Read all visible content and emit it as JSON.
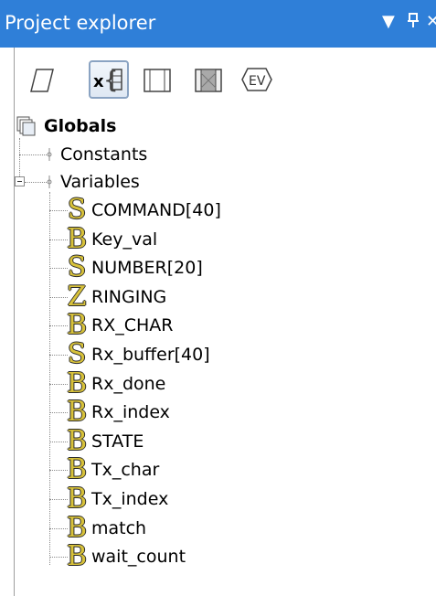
{
  "panel": {
    "title": "Project explorer"
  },
  "titlebar_icons": {
    "dropdown": "dropdown-arrow-icon",
    "pin": "pin-icon",
    "close": "close-icon"
  },
  "toolbar": {
    "tools": [
      {
        "name": "flowchart-icon",
        "active": false
      },
      {
        "name": "variables-icon",
        "active": true
      },
      {
        "name": "macro-icon",
        "active": false
      },
      {
        "name": "component-macro-icon",
        "active": false
      },
      {
        "name": "events-icon",
        "active": false,
        "label": "EV"
      }
    ]
  },
  "tree": {
    "root": {
      "label": "Globals"
    },
    "constants": {
      "label": "Constants"
    },
    "variables": {
      "label": "Variables",
      "items": [
        {
          "type": "S",
          "label": "COMMAND[40]"
        },
        {
          "type": "B",
          "label": "Key_val"
        },
        {
          "type": "S",
          "label": "NUMBER[20]"
        },
        {
          "type": "Z",
          "label": "RINGING"
        },
        {
          "type": "B",
          "label": "RX_CHAR"
        },
        {
          "type": "S",
          "label": "Rx_buffer[40]"
        },
        {
          "type": "B",
          "label": "Rx_done"
        },
        {
          "type": "B",
          "label": "Rx_index"
        },
        {
          "type": "B",
          "label": "STATE"
        },
        {
          "type": "B",
          "label": "Tx_char"
        },
        {
          "type": "B",
          "label": "Tx_index"
        },
        {
          "type": "B",
          "label": "match"
        },
        {
          "type": "B",
          "label": "wait_count"
        }
      ]
    }
  }
}
